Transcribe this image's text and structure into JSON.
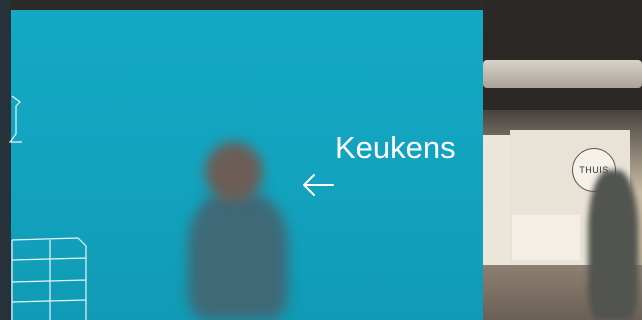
{
  "sign": {
    "label": "Keukens",
    "arrow": "left-arrow-icon"
  },
  "showroom": {
    "logo_text": "THUIS"
  },
  "colors": {
    "wall": "#12a3be",
    "sign_text": "#ffffff"
  }
}
